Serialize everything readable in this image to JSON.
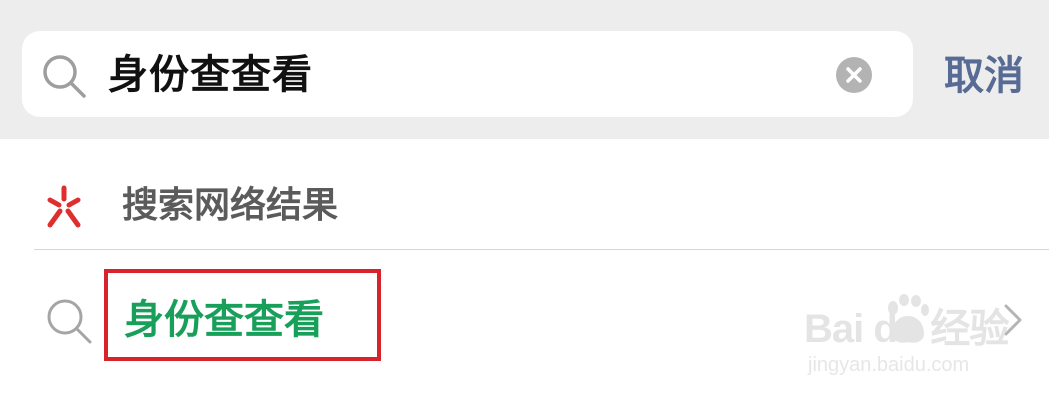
{
  "search": {
    "query": "身份查查看",
    "cancel_label": "取消"
  },
  "web_results": {
    "label": "搜索网络结果"
  },
  "suggestion": {
    "text": "身份查查看"
  },
  "watermark": {
    "logo": "Bai du 经验",
    "url": "jingyan.baidu.com"
  },
  "colors": {
    "accent_link": "#576b95",
    "suggestion_green": "#18a05a",
    "highlight_red": "#d7242c",
    "web_icon_red": "#e02d2d"
  },
  "icons": {
    "search": "search-icon",
    "clear": "clear-icon",
    "web": "web-search-icon",
    "chevron": "chevron-right-icon"
  }
}
